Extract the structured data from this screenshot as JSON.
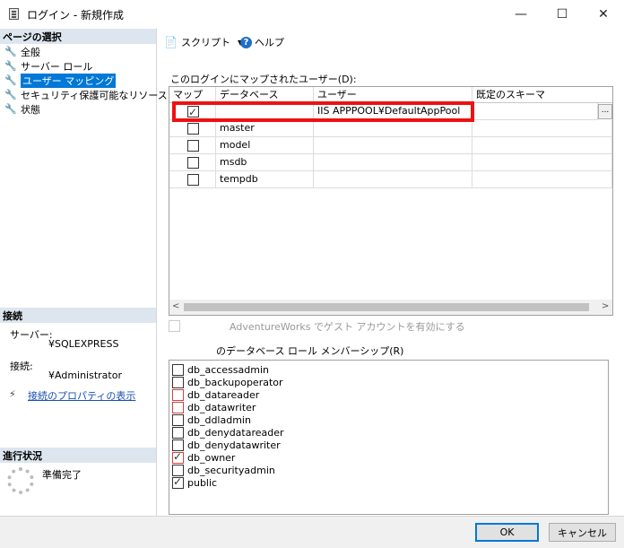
{
  "window": {
    "title": "ログイン - 新規作成",
    "minimize": "—",
    "maximize": "☐",
    "close": "✕"
  },
  "left": {
    "page_select_header": "ページの選択",
    "nav": [
      "全般",
      "サーバー ロール",
      "ユーザー マッピング",
      "セキュリティ保護可能なリソース",
      "状態"
    ],
    "connection_header": "接続",
    "server_label": "サーバー:",
    "server_value": "¥SQLEXPRESS",
    "connection_label": "接続:",
    "connection_value": "¥Administrator",
    "connection_props_link": "接続のプロパティの表示",
    "progress_header": "進行状況",
    "progress_status": "準備完了"
  },
  "toolbar": {
    "script_label": "スクリプト",
    "help_label": "ヘルプ"
  },
  "mapping": {
    "title": "このログインにマップされたユーザー(D):",
    "headers": [
      "マップ",
      "データベース",
      "ユーザー",
      "既定のスキーマ"
    ],
    "rows": [
      {
        "mapped": true,
        "database": "",
        "user": "IIS APPPOOL¥DefaultAppPool",
        "schema": ""
      },
      {
        "mapped": false,
        "database": "master",
        "user": "",
        "schema": ""
      },
      {
        "mapped": false,
        "database": "model",
        "user": "",
        "schema": ""
      },
      {
        "mapped": false,
        "database": "msdb",
        "user": "",
        "schema": ""
      },
      {
        "mapped": false,
        "database": "tempdb",
        "user": "",
        "schema": ""
      }
    ],
    "ellipsis": "..."
  },
  "guest": {
    "label": "AdventureWorks でゲスト アカウントを有効にする"
  },
  "roles": {
    "title": "のデータベース ロール メンバーシップ(R)",
    "items": [
      {
        "name": "db_accessadmin",
        "checked": false
      },
      {
        "name": "db_backupoperator",
        "checked": false
      },
      {
        "name": "db_datareader",
        "checked": false
      },
      {
        "name": "db_datawriter",
        "checked": false
      },
      {
        "name": "db_ddladmin",
        "checked": false
      },
      {
        "name": "db_denydatareader",
        "checked": false
      },
      {
        "name": "db_denydatawriter",
        "checked": false
      },
      {
        "name": "db_owner",
        "checked": true
      },
      {
        "name": "db_securityadmin",
        "checked": false
      },
      {
        "name": "public",
        "checked": true
      }
    ]
  },
  "buttons": {
    "ok": "OK",
    "cancel": "キャンセル"
  },
  "colors": {
    "selection": "#0078d7",
    "header_bg": "#dde6ef",
    "highlight_box": "#ee1111",
    "link": "#1a4fb0"
  }
}
